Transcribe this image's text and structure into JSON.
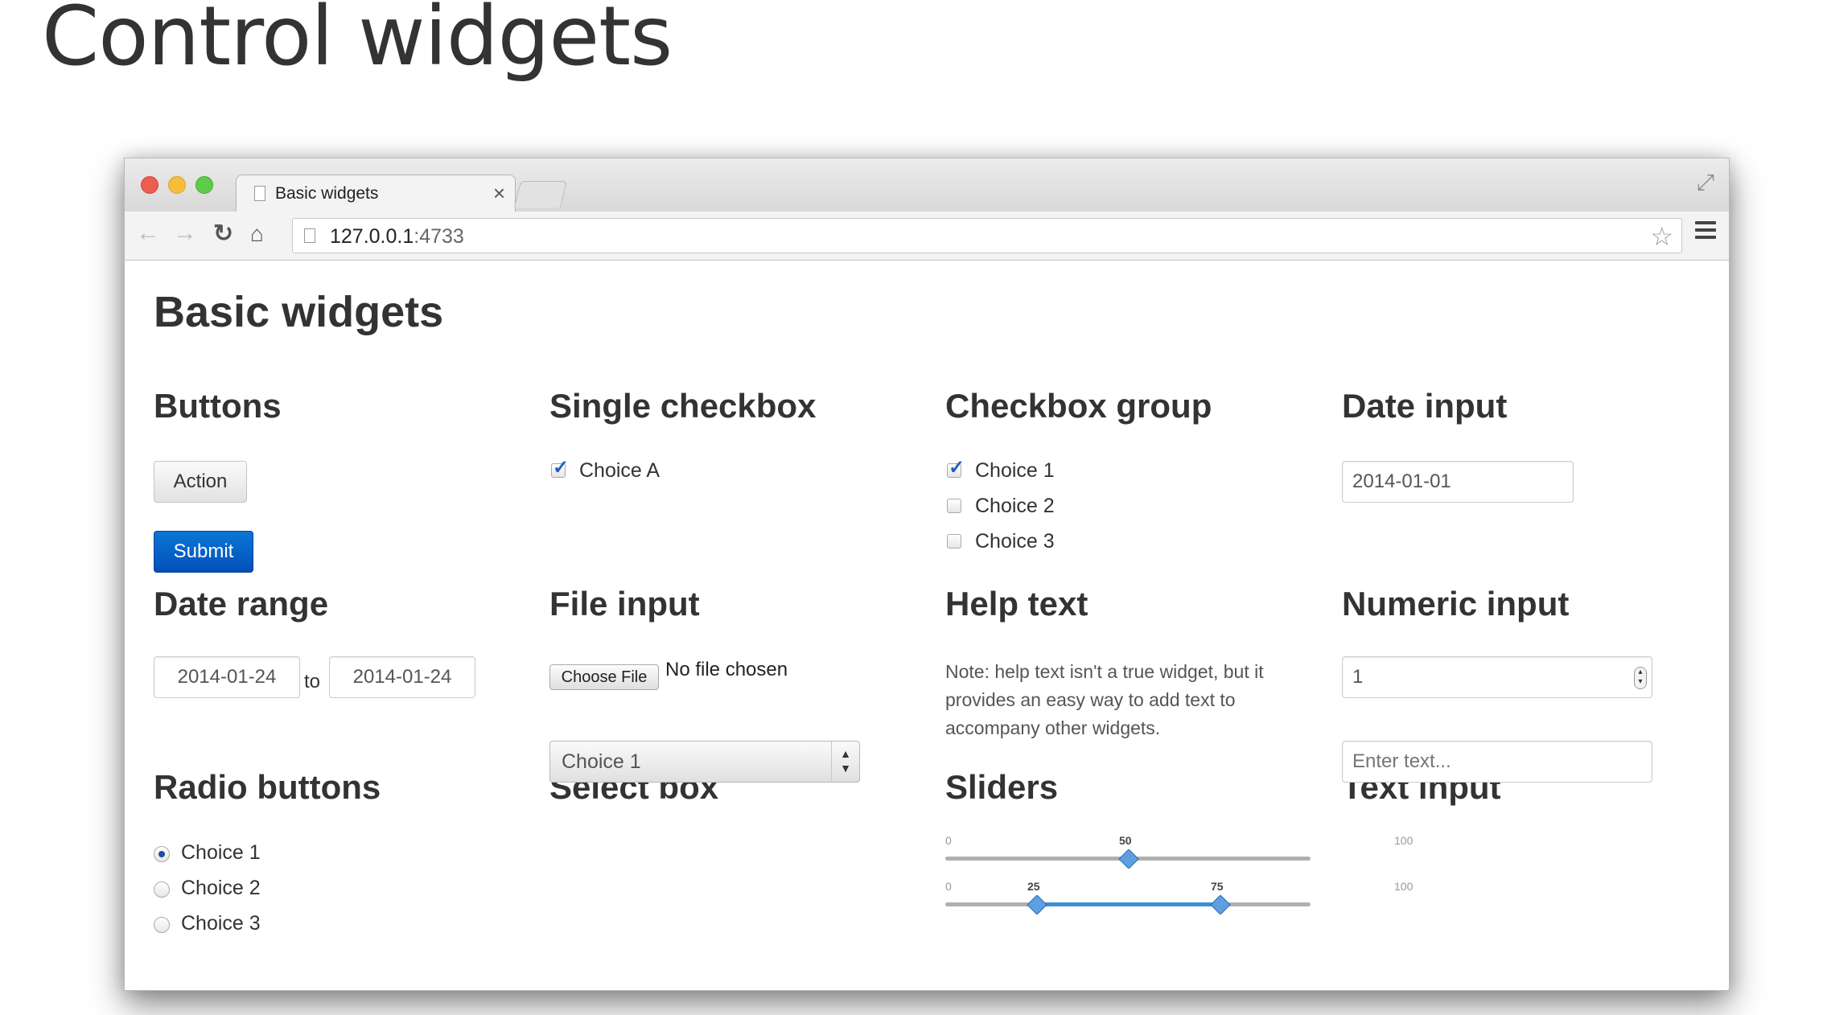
{
  "slide": {
    "title": "Control widgets"
  },
  "browser": {
    "tab_title": "Basic widgets",
    "tab_close": "×",
    "url_host": "127.0.0.1",
    "url_port": ":4733"
  },
  "page": {
    "title": "Basic widgets",
    "buttons": {
      "heading": "Buttons",
      "action_label": "Action",
      "submit_label": "Submit"
    },
    "single_checkbox": {
      "heading": "Single checkbox",
      "label": "Choice A",
      "checked": true
    },
    "checkbox_group": {
      "heading": "Checkbox group",
      "items": [
        {
          "label": "Choice 1",
          "checked": true
        },
        {
          "label": "Choice 2",
          "checked": false
        },
        {
          "label": "Choice 3",
          "checked": false
        }
      ]
    },
    "date_input": {
      "heading": "Date input",
      "value": "2014-01-01"
    },
    "date_range": {
      "heading": "Date range",
      "start": "2014-01-24",
      "separator": "to",
      "end": "2014-01-24"
    },
    "file_input": {
      "heading": "File input",
      "button_label": "Choose File",
      "status": "No file chosen"
    },
    "help_text": {
      "heading": "Help text",
      "body": "Note: help text isn't a true widget, but it provides an easy way to add text to accompany other widgets."
    },
    "numeric_input": {
      "heading": "Numeric input",
      "value": "1"
    },
    "radio_buttons": {
      "heading": "Radio buttons",
      "items": [
        {
          "label": "Choice 1",
          "selected": true
        },
        {
          "label": "Choice 2",
          "selected": false
        },
        {
          "label": "Choice 3",
          "selected": false
        }
      ]
    },
    "select_box": {
      "heading": "Select box",
      "selected": "Choice 1"
    },
    "sliders": {
      "heading": "Sliders",
      "single": {
        "min": "0",
        "max": "100",
        "value": "50"
      },
      "range": {
        "min": "0",
        "max": "100",
        "low": "25",
        "high": "75"
      }
    },
    "text_input": {
      "heading": "Text input",
      "placeholder": "Enter text..."
    }
  }
}
